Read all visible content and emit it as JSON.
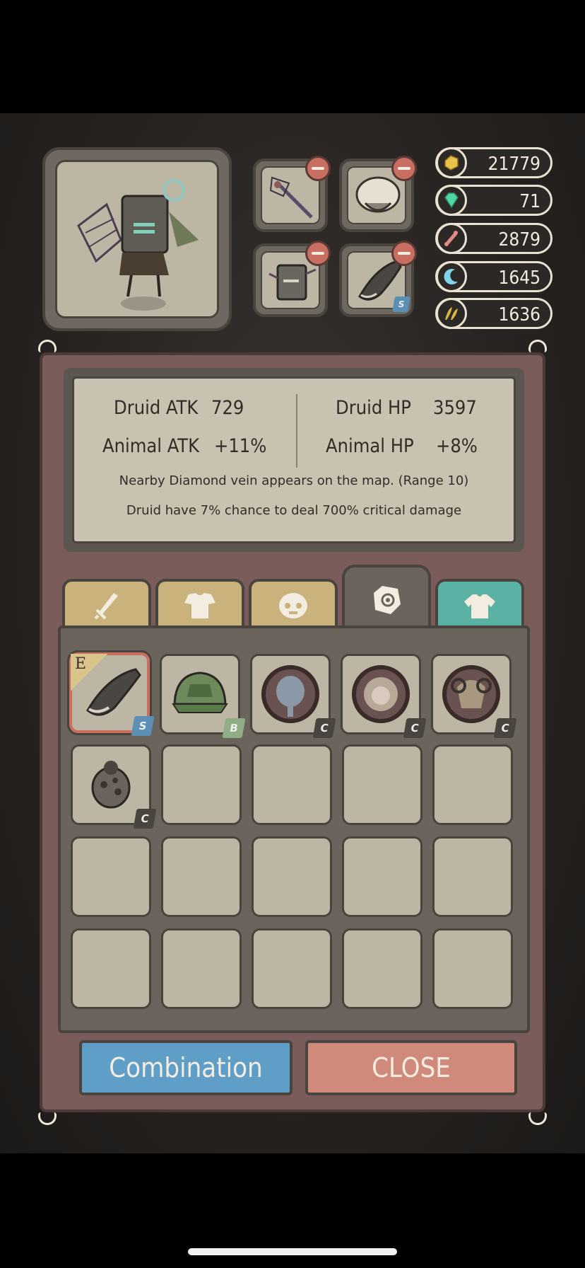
{
  "resources": [
    {
      "icon": "gold-nugget-icon",
      "value": "21779",
      "color": "#e8c14a"
    },
    {
      "icon": "gem-icon",
      "value": "71",
      "color": "#4fd8a4"
    },
    {
      "icon": "bone-icon",
      "value": "2879",
      "color": "#e08a8a"
    },
    {
      "icon": "crescent-icon",
      "value": "1645",
      "color": "#7fd2e8"
    },
    {
      "icon": "wing-icon",
      "value": "1636",
      "color": "#d9b440"
    }
  ],
  "stats": {
    "druid_atk_label": "Druid ATK",
    "druid_atk_value": "729",
    "druid_hp_label": "Druid HP",
    "druid_hp_value": "3597",
    "animal_atk_label": "Animal ATK",
    "animal_atk_value": "+11%",
    "animal_hp_label": "Animal HP",
    "animal_hp_value": "+8%",
    "desc1": "Nearby Diamond vein appears on the map. (Range 10)",
    "desc2": "Druid have 7% chance to deal 700% critical damage"
  },
  "tabs": [
    {
      "icon": "sword-icon"
    },
    {
      "icon": "armor-icon"
    },
    {
      "icon": "skull-mask-icon"
    },
    {
      "icon": "relic-icon",
      "active": true
    },
    {
      "icon": "shirt-icon"
    }
  ],
  "inventory": [
    {
      "item": "horn-icon",
      "grade": "S",
      "equipped_badge": "E"
    },
    {
      "item": "turtle-shell-icon",
      "grade": "B"
    },
    {
      "item": "elephant-totem-icon",
      "grade": "C"
    },
    {
      "item": "lion-totem-icon",
      "grade": "C"
    },
    {
      "item": "ram-totem-icon",
      "grade": "C"
    },
    {
      "item": "ladybug-icon",
      "grade": "C"
    }
  ],
  "buttons": {
    "combination": "Combination",
    "close": "CLOSE"
  }
}
